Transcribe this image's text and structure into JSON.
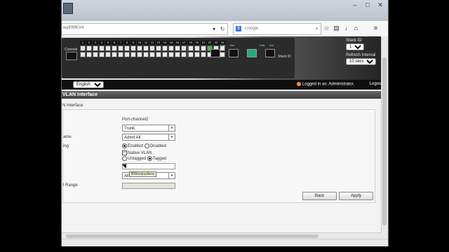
{
  "browser": {
    "url": "wyEf9fKV4",
    "search_placeholder": "Google",
    "search_engine_glyph": "8",
    "window_buttons": [
      "–",
      "□",
      "✕"
    ]
  },
  "switch_panel": {
    "console_label": "Console",
    "stack_id_label": "Stack ID",
    "port_numbers": [
      "1",
      "2",
      "3",
      "4",
      "5",
      "6",
      "7",
      "8",
      "9",
      "10",
      "11",
      "12",
      "13",
      "14",
      "15",
      "16",
      "17",
      "18",
      "19",
      "20",
      "21",
      "22",
      "23",
      "24"
    ],
    "sfp_labels": [
      "Link",
      "Act",
      "Link",
      "Act"
    ],
    "green_ports": [
      21
    ]
  },
  "stack_panel": {
    "stack_id_label": "Stack ID",
    "stack_id_value": "1",
    "refresh_label": "Refresh Interval",
    "refresh_value": "10 secs"
  },
  "lang": {
    "value": "English"
  },
  "session": {
    "logged_in": "Logged in as: Administrator,",
    "logout": "Logout"
  },
  "page": {
    "title": "VLAN Interface",
    "section": "N Interface",
    "interface_value": "Port-channel2",
    "mode_value": "Trunk",
    "frame_label": "ame",
    "frame_value": "Admit All",
    "filtering_label": "ing",
    "filter_enabled": "Enabled",
    "filter_disabled": "Disabled",
    "native_vlan": "Native VLAN",
    "untagged": "Untagged",
    "tagged": "Tagged",
    "all_value": "All",
    "tooltip": "BW/nstrucltera",
    "range_label": "l Range",
    "back_button": "Back",
    "apply_button": "Apply"
  },
  "colors": {
    "header_dark": "#3d3d3d",
    "port_green": "#3bbf3b",
    "bg": "#000000"
  }
}
